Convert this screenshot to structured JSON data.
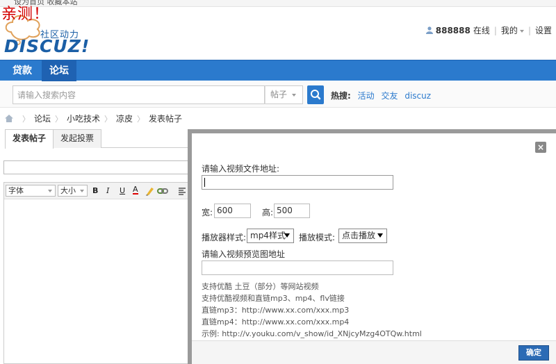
{
  "top_strip": {
    "text": "设为首页  收藏本站"
  },
  "watermark": "亲测！",
  "logo": {
    "slogan": "社区动力",
    "brand": "DISCUZ!"
  },
  "userbar": {
    "online_count": "888888",
    "online_label": "在线",
    "mine_label": "我的",
    "settings_label": "设置"
  },
  "nav": {
    "items": [
      "贷款",
      "论坛"
    ],
    "active": "论坛"
  },
  "search": {
    "placeholder": "请输入搜索内容",
    "type_value": "帖子",
    "hot_label": "热搜:",
    "hot_terms": [
      "活动",
      "交友",
      "discuz"
    ]
  },
  "breadcrumb": [
    "论坛",
    "小吃技术",
    "凉皮",
    "发表帖子"
  ],
  "tabs": [
    "发表帖子",
    "发起投票"
  ],
  "editor": {
    "font_select": "字体",
    "size_select": "大小",
    "bold": "B",
    "italic": "I",
    "underline": "U",
    "color": "A"
  },
  "dialog": {
    "video_url_label": "请输入视频文件地址:",
    "video_url_value": "",
    "width_label": "宽:",
    "width_value": "600",
    "height_label": "高:",
    "height_value": "500",
    "player_style_label": "播放器样式:",
    "player_style_value": "mp4样式",
    "play_mode_label": "播放模式:",
    "play_mode_value": "点击播放",
    "preview_label": "请输入视频预览图地址",
    "preview_value": "",
    "hints": [
      "支持优酷 土豆（部分）等网站视频",
      "支持优酷视频和直链mp3、mp4、flv链接",
      "直链mp3：http://www.xx.com/xxx.mp3",
      "直链mp4：http://www.xx.com/xxx.mp4",
      "示例: http://v.youku.com/v_show/id_XNjcyMzg4OTQw.html"
    ],
    "ok_label": "确定"
  },
  "colors": {
    "accent": "#2b7acd",
    "nav_active": "#1f62b2",
    "watermark": "#d40000"
  }
}
